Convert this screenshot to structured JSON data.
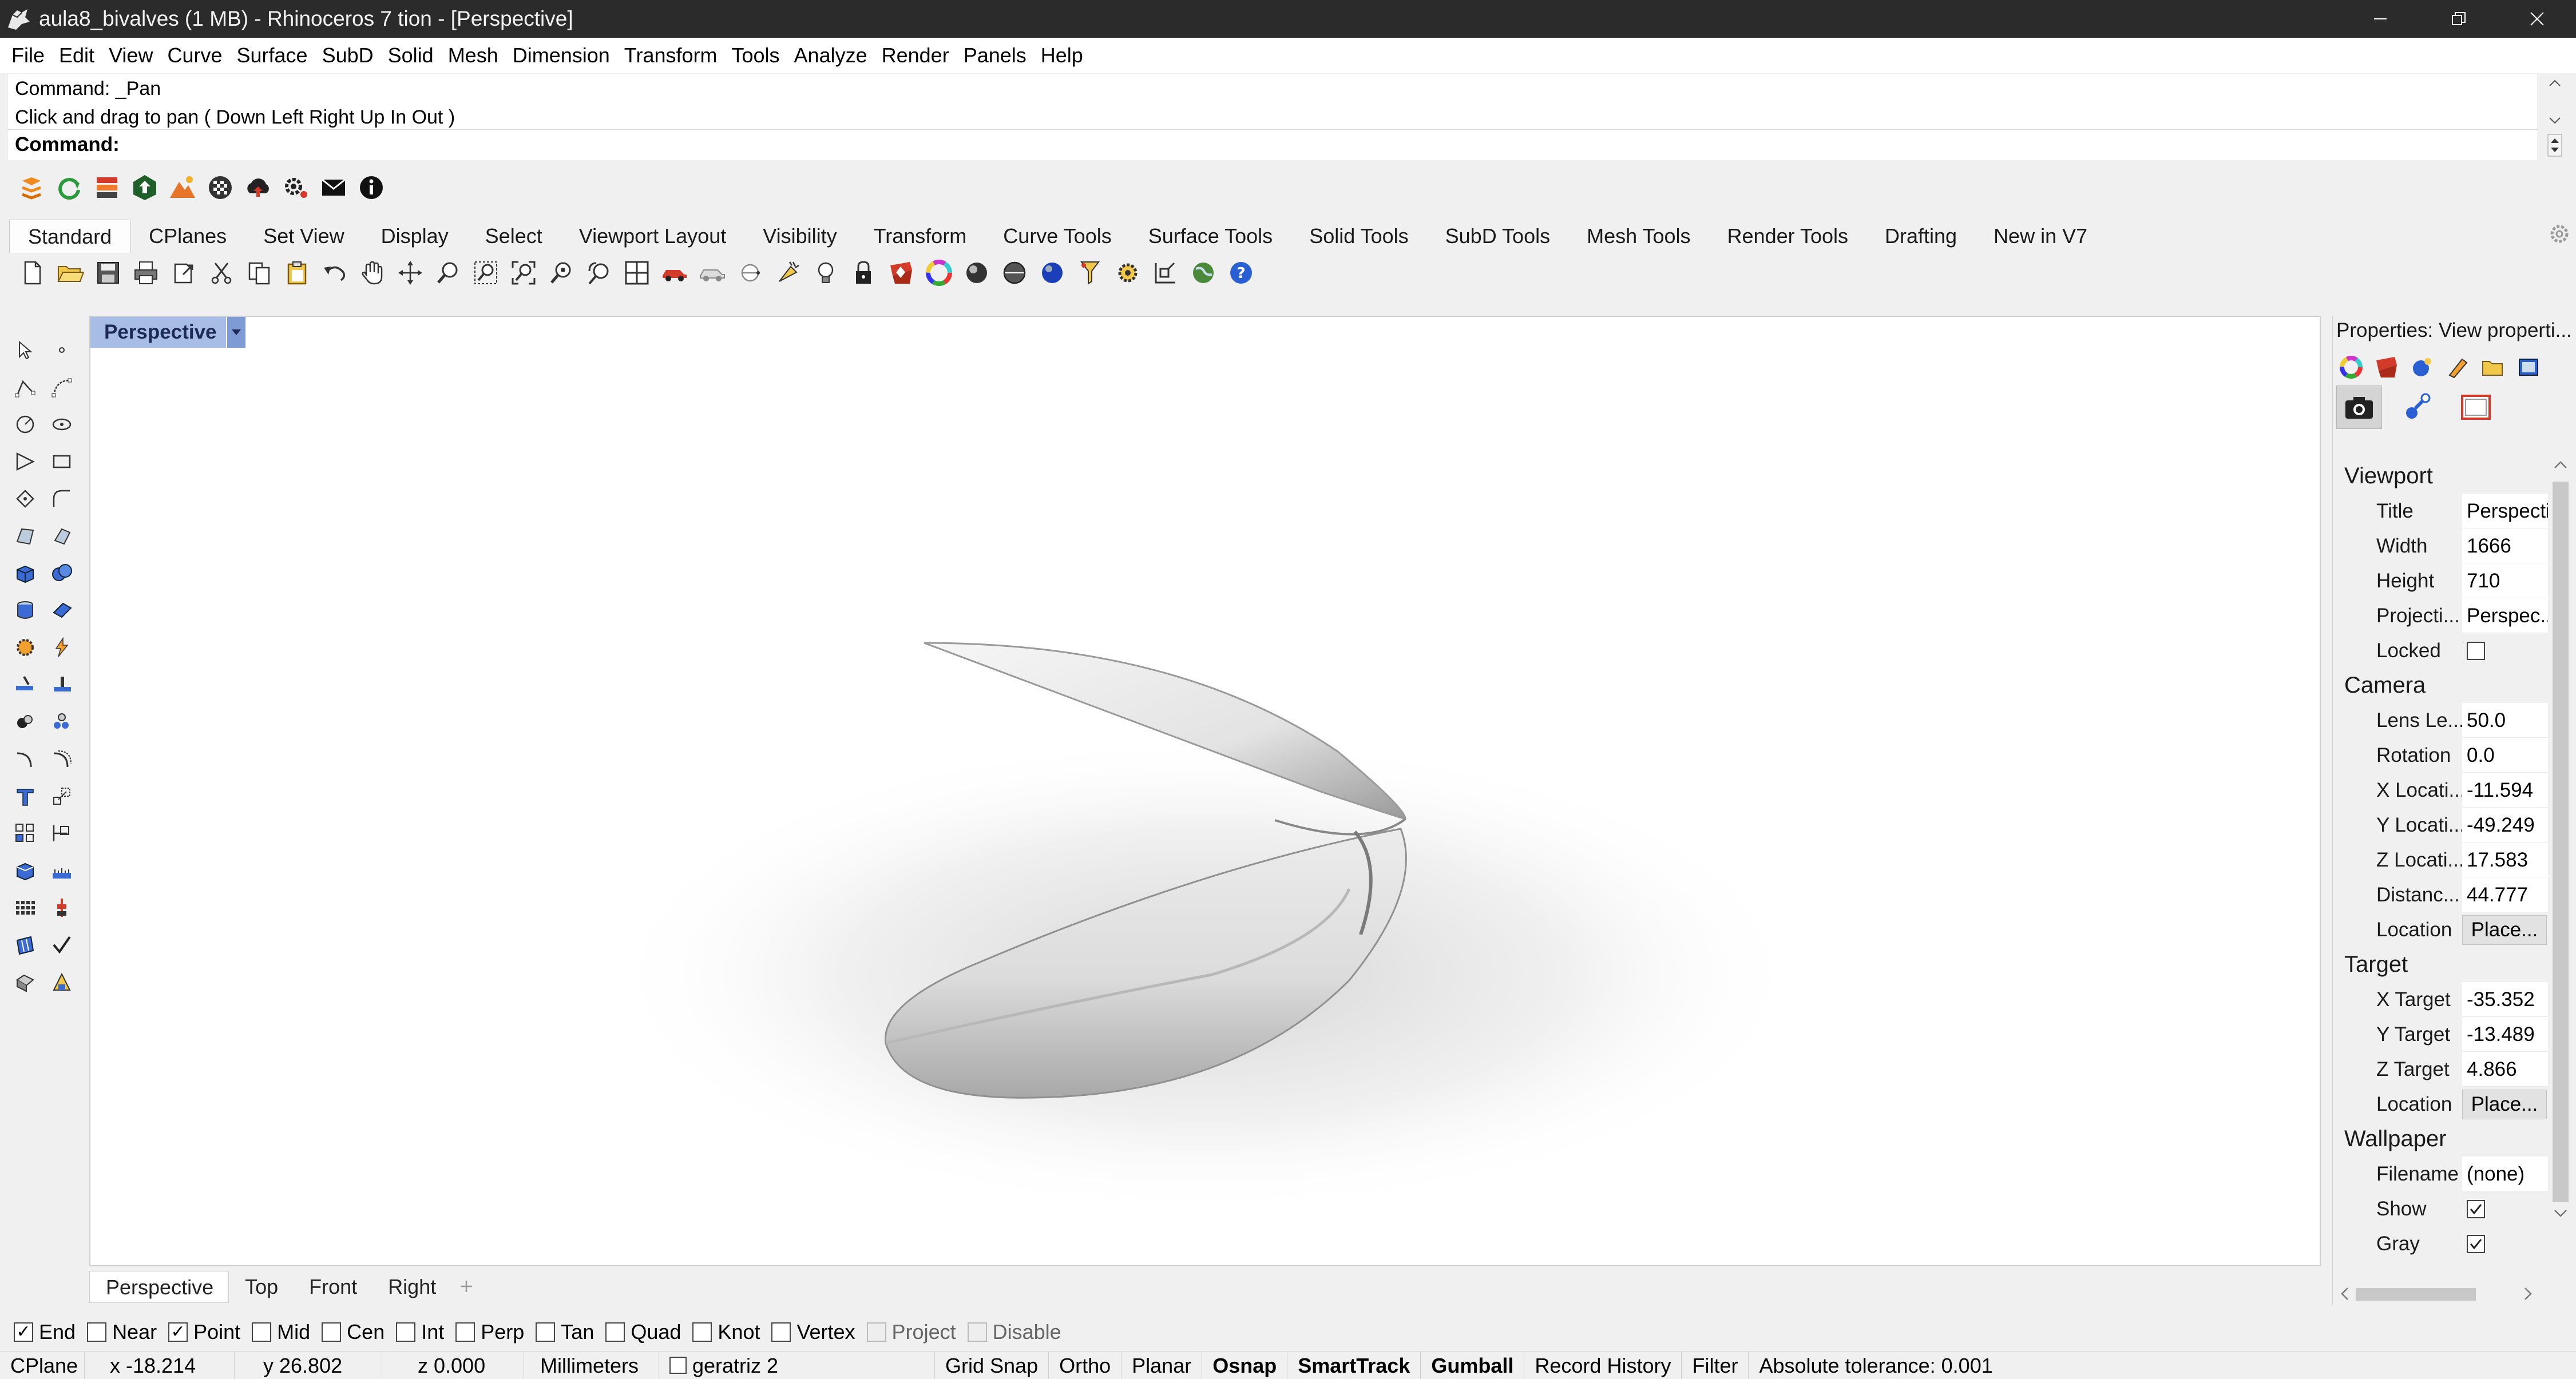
{
  "window": {
    "title": "aula8_bivalves (1 MB) - Rhinoceros 7 tion - [Perspective]",
    "minimize_icon": "minimize-icon",
    "restore_icon": "restore-icon",
    "close_icon": "close-icon"
  },
  "menu": [
    "File",
    "Edit",
    "View",
    "Curve",
    "Surface",
    "SubD",
    "Solid",
    "Mesh",
    "Dimension",
    "Transform",
    "Tools",
    "Analyze",
    "Render",
    "Panels",
    "Help"
  ],
  "command": {
    "history": [
      "Command: _Pan",
      "Click and drag to pan ( Down  Left  Right  Up  In  Out )"
    ],
    "prompt": "Command:"
  },
  "toolbar_tabs": [
    "Standard",
    "CPlanes",
    "Set View",
    "Display",
    "Select",
    "Viewport Layout",
    "Visibility",
    "Transform",
    "Curve Tools",
    "Surface Tools",
    "Solid Tools",
    "SubD Tools",
    "Mesh Tools",
    "Render Tools",
    "Drafting",
    "New in V7"
  ],
  "active_tab": "Standard",
  "viewport": {
    "label": "Perspective"
  },
  "viewport_tabs": [
    "Perspective",
    "Top",
    "Front",
    "Right"
  ],
  "properties": {
    "title": "Properties: View properti...",
    "sections": {
      "viewport": {
        "heading": "Viewport",
        "title_label": "Title",
        "title_value": "Perspecti...",
        "width_label": "Width",
        "width_value": "1666",
        "height_label": "Height",
        "height_value": "710",
        "projection_label": "Projecti...",
        "projection_value": "Perspec...",
        "locked_label": "Locked",
        "locked_value": false
      },
      "camera": {
        "heading": "Camera",
        "lens_label": "Lens Le...",
        "lens_value": "50.0",
        "rotation_label": "Rotation",
        "rotation_value": "0.0",
        "xloc_label": "X Locati...",
        "xloc_value": "-11.594",
        "yloc_label": "Y Locati...",
        "yloc_value": "-49.249",
        "zloc_label": "Z Locati...",
        "zloc_value": "17.583",
        "dist_label": "Distanc...",
        "dist_value": "44.777",
        "location_label": "Location",
        "location_button": "Place..."
      },
      "target": {
        "heading": "Target",
        "xt_label": "X Target",
        "xt_value": "-35.352",
        "yt_label": "Y Target",
        "yt_value": "-13.489",
        "zt_label": "Z Target",
        "zt_value": "4.866",
        "location_label": "Location",
        "location_button": "Place..."
      },
      "wallpaper": {
        "heading": "Wallpaper",
        "filename_label": "Filename",
        "filename_value": "(none)",
        "show_label": "Show",
        "show_value": true,
        "gray_label": "Gray",
        "gray_value": true
      }
    }
  },
  "osnap": [
    {
      "label": "End",
      "checked": true,
      "enabled": true
    },
    {
      "label": "Near",
      "checked": false,
      "enabled": true
    },
    {
      "label": "Point",
      "checked": true,
      "enabled": true
    },
    {
      "label": "Mid",
      "checked": false,
      "enabled": true
    },
    {
      "label": "Cen",
      "checked": false,
      "enabled": true
    },
    {
      "label": "Int",
      "checked": false,
      "enabled": true
    },
    {
      "label": "Perp",
      "checked": false,
      "enabled": true
    },
    {
      "label": "Tan",
      "checked": false,
      "enabled": true
    },
    {
      "label": "Quad",
      "checked": false,
      "enabled": true
    },
    {
      "label": "Knot",
      "checked": false,
      "enabled": true
    },
    {
      "label": "Vertex",
      "checked": false,
      "enabled": true
    },
    {
      "label": "Project",
      "checked": false,
      "enabled": false
    },
    {
      "label": "Disable",
      "checked": false,
      "enabled": false
    }
  ],
  "status": {
    "cplane": "CPlane",
    "x": "x -18.214",
    "y": "y 26.802",
    "z": "z 0.000",
    "units": "Millimeters",
    "layer": "geratriz 2",
    "grid_snap": "Grid Snap",
    "ortho": "Ortho",
    "planar": "Planar",
    "osnap": "Osnap",
    "smarttrack": "SmartTrack",
    "gumball": "Gumball",
    "record_history": "Record History",
    "filter": "Filter",
    "tolerance": "Absolute tolerance: 0.001"
  },
  "colors": {
    "titlebar": "#2b2b2b",
    "viewport_label": "#a8bde6",
    "viewport_bg": "#ffffff"
  }
}
